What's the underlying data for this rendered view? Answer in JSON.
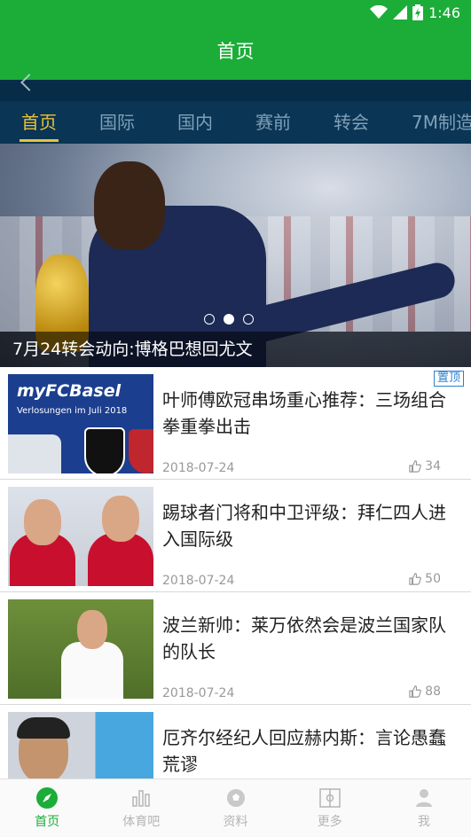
{
  "status": {
    "time": "1:46"
  },
  "header": {
    "title": "首页"
  },
  "tabs": [
    {
      "label": "首页",
      "active": true
    },
    {
      "label": "国际"
    },
    {
      "label": "国内"
    },
    {
      "label": "赛前"
    },
    {
      "label": "转会"
    },
    {
      "label": "7M制造"
    }
  ],
  "hero": {
    "caption": "7月24转会动向:博格巴想回尤文",
    "active_dot": 2,
    "dot_count": 3
  },
  "news": [
    {
      "headline": "叶师傅欧冠串场重心推荐：三场组合拳重拳出击",
      "date": "2018-07-24",
      "likes": "34",
      "pin": "置顶",
      "thumb_text": "myFCBasel",
      "thumb_sub": "Verlosungen im Juli 2018"
    },
    {
      "headline": "踢球者门将和中卫评级：拜仁四人进入国际级",
      "date": "2018-07-24",
      "likes": "50"
    },
    {
      "headline": "波兰新帅：莱万依然会是波兰国家队的队长",
      "date": "2018-07-24",
      "likes": "88"
    },
    {
      "headline": "厄齐尔经纪人回应赫内斯：言论愚蠢荒谬"
    }
  ],
  "nav": [
    {
      "label": "首页",
      "icon": "compass-icon",
      "active": true
    },
    {
      "label": "体育吧",
      "icon": "bar-chart-icon"
    },
    {
      "label": "资料",
      "icon": "soccer-ball-icon"
    },
    {
      "label": "更多",
      "icon": "field-icon"
    },
    {
      "label": "我",
      "icon": "user-icon"
    }
  ],
  "colors": {
    "primary": "#1bad38",
    "tab_bg": "#0a3554",
    "tab_active": "#e8c23a"
  }
}
